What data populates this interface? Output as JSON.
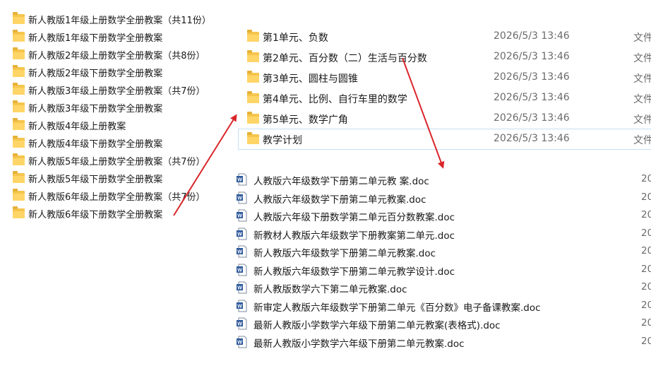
{
  "left_folders": [
    "新人教版1年级上册数学全册教案（共11份）",
    "新人教版1年级下册数学全册教案",
    "新人教版2年级上册数学全册教案（共8份）",
    "新人教版2年级下册数学全册教案",
    "新人教版3年级上册数学全册教案（共7份）",
    "新人教版3年级下册数学全册教案",
    "新人教版4年级上册教案",
    "新人教版4年级下册数学全册教案",
    "新人教版5年级上册数学全册教案（共7份）",
    "新人教版5年级下册数学全册教案",
    "新人教版6年级上册数学全册教案（共7份）",
    "新人教版6年级下册数学全册教案"
  ],
  "unit_folders": [
    {
      "name": "第1单元、负数",
      "date": "2026/5/3 13:46",
      "type": "文件"
    },
    {
      "name": "第2单元、百分数（二）生活与百分数",
      "date": "2026/5/3 13:46",
      "type": "文件"
    },
    {
      "name": "第3单元、圆柱与圆锥",
      "date": "2026/5/3 13:46",
      "type": "文件"
    },
    {
      "name": "第4单元、比例、自行车里的数学",
      "date": "2026/5/3 13:46",
      "type": "文件"
    },
    {
      "name": "第5单元、数学广角",
      "date": "2026/5/3 13:46",
      "type": "文件"
    },
    {
      "name": "教学计划",
      "date": "2026/5/3 13:46",
      "type": "文件"
    }
  ],
  "doc_files": [
    {
      "name": "人教版六年级数学下册第二单元教 案.doc",
      "date": "20"
    },
    {
      "name": "人教版六年级数学下册第二单元教案.doc",
      "date": "20"
    },
    {
      "name": "人教版六年级下册数学第二单元百分数教案.doc",
      "date": "20"
    },
    {
      "name": "新教材人教版六年级数学下册教案第二单元.doc",
      "date": "20"
    },
    {
      "name": "新人教版六年级数学下册第二单元教案.doc",
      "date": "20"
    },
    {
      "name": "新人教版六年级数学下册第二单元教学设计.doc",
      "date": "20"
    },
    {
      "name": "新人教版数学六下第二单元教案.doc",
      "date": "20"
    },
    {
      "name": "新审定人教版六年级数学下册第二单元《百分数》电子备课教案.doc",
      "date": "20"
    },
    {
      "name": "最新人教版小学数学六年级下册第二单元教案(表格式).doc",
      "date": "20"
    },
    {
      "name": "最新人教版小学数学六年级下册第二单元教案.doc",
      "date": "20"
    }
  ],
  "colors": {
    "folder": "#f5c54c",
    "arrow": "#d9262b",
    "selection_border": "#c5dff6",
    "word_icon": "#2b579a"
  },
  "icons": {
    "folder": "folder-icon",
    "document": "word-doc-icon"
  }
}
